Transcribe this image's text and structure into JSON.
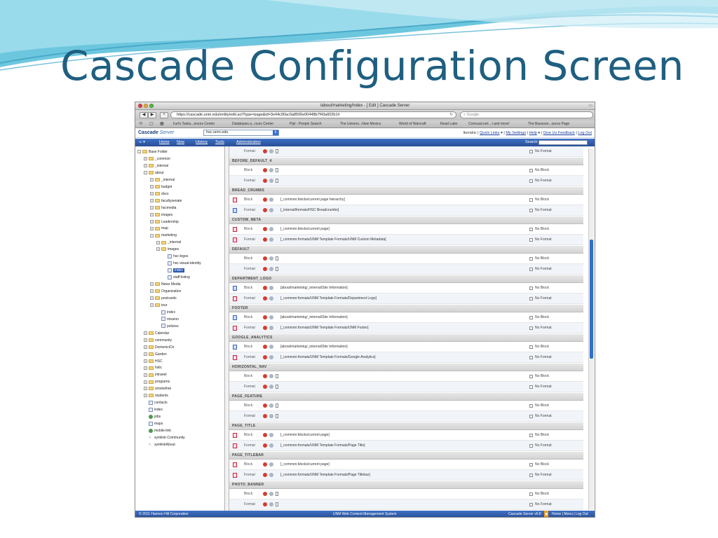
{
  "slide": {
    "title": "Cascade Configuration Screen"
  },
  "browser": {
    "window_title": "/about/marketing/index - [ Edit ] Cascade Server",
    "url": "https://cascade.unm.edu/entity/edit.act?type=page&id=3e44c90ac0a8506e00448b7f43a602b1#",
    "search_placeholder": "Google",
    "bookmarks": [
      "Icel's Tasks...ences Center",
      "Databases a...nces Center",
      "Pipl - People Search",
      "The Univers...New Mexico",
      "World of Warcraft",
      "Read Later",
      "Comcast.net:...l and more!",
      "The Bassoon...ource Page"
    ]
  },
  "app": {
    "logo_main": "Cascade",
    "logo_sub": "Server",
    "site": "hsc.unm.edu",
    "user": "lkendric",
    "links": [
      "Quick Links",
      "My Settings",
      "Help",
      "Give Us Feedback",
      "Log Out"
    ],
    "menu": [
      "Home",
      "New",
      "History",
      "Tools",
      "Administration"
    ],
    "search_label": "Search"
  },
  "tree": [
    {
      "label": "Base Folder",
      "indent": 0,
      "icon": "folder",
      "exp": "-"
    },
    {
      "label": "_common",
      "indent": 1,
      "icon": "folder",
      "exp": "+"
    },
    {
      "label": "_internal",
      "indent": 1,
      "icon": "folder",
      "exp": "+"
    },
    {
      "label": "about",
      "indent": 1,
      "icon": "folder",
      "exp": "-"
    },
    {
      "label": "_internal",
      "indent": 2,
      "icon": "folder",
      "exp": "+"
    },
    {
      "label": "budget",
      "indent": 2,
      "icon": "folder",
      "exp": "+"
    },
    {
      "label": "docs",
      "indent": 2,
      "icon": "folder",
      "exp": "+"
    },
    {
      "label": "facultysenate",
      "indent": 2,
      "icon": "folder",
      "exp": "+"
    },
    {
      "label": "hscmedia",
      "indent": 2,
      "icon": "folder",
      "exp": "+"
    },
    {
      "label": "images",
      "indent": 2,
      "icon": "folder",
      "exp": "+"
    },
    {
      "label": "Leadership",
      "indent": 2,
      "icon": "folder",
      "exp": "+"
    },
    {
      "label": "map",
      "indent": 2,
      "icon": "folder",
      "exp": "+"
    },
    {
      "label": "marketing",
      "indent": 2,
      "icon": "folder",
      "exp": "-"
    },
    {
      "label": "_internal",
      "indent": 3,
      "icon": "folder",
      "exp": "+"
    },
    {
      "label": "images",
      "indent": 3,
      "icon": "folder",
      "exp": "+"
    },
    {
      "label": "hsc-logos",
      "indent": 4,
      "icon": "page"
    },
    {
      "label": "hsc-visual-identity",
      "indent": 4,
      "icon": "page"
    },
    {
      "label": "index",
      "indent": 4,
      "icon": "page",
      "selected": true
    },
    {
      "label": "staff-listing",
      "indent": 4,
      "icon": "page"
    },
    {
      "label": "News Media",
      "indent": 2,
      "icon": "folder",
      "exp": "+"
    },
    {
      "label": "Organization",
      "indent": 2,
      "icon": "folder",
      "exp": "+"
    },
    {
      "label": "postcards",
      "indent": 2,
      "icon": "folder",
      "exp": "+"
    },
    {
      "label": "tour",
      "indent": 2,
      "icon": "folder",
      "exp": "+"
    },
    {
      "label": "index",
      "indent": 3,
      "icon": "page"
    },
    {
      "label": "mission",
      "indent": 3,
      "icon": "page"
    },
    {
      "label": "policies",
      "indent": 3,
      "icon": "page"
    },
    {
      "label": "Calendar",
      "indent": 1,
      "icon": "folder",
      "exp": "+"
    },
    {
      "label": "community",
      "indent": 1,
      "icon": "folder",
      "exp": "+"
    },
    {
      "label": "DomeniciCtr",
      "indent": 1,
      "icon": "folder",
      "exp": "+"
    },
    {
      "label": "Garden",
      "indent": 1,
      "icon": "folder",
      "exp": "+"
    },
    {
      "label": "HSC",
      "indent": 1,
      "icon": "folder",
      "exp": "+"
    },
    {
      "label": "hslic",
      "indent": 1,
      "icon": "folder",
      "exp": "+"
    },
    {
      "label": "intranet",
      "indent": 1,
      "icon": "folder",
      "exp": "+"
    },
    {
      "label": "programs",
      "indent": 1,
      "icon": "folder",
      "exp": "+"
    },
    {
      "label": "smokefree",
      "indent": 1,
      "icon": "folder",
      "exp": "+"
    },
    {
      "label": "students",
      "indent": 1,
      "icon": "folder",
      "exp": "+"
    },
    {
      "label": "contacts",
      "indent": 1,
      "icon": "page"
    },
    {
      "label": "index",
      "indent": 1,
      "icon": "page"
    },
    {
      "label": "jobs",
      "indent": 1,
      "icon": "globe"
    },
    {
      "label": "maps",
      "indent": 1,
      "icon": "page"
    },
    {
      "label": "mobile-link",
      "indent": 1,
      "icon": "globe"
    },
    {
      "label": "symlink-Community",
      "indent": 1,
      "icon": "symlink"
    },
    {
      "label": "symlinkAbout",
      "indent": 1,
      "icon": "symlink"
    }
  ],
  "regions": [
    {
      "kind": "format",
      "path": "[]",
      "icon": "none"
    },
    {
      "kind": "section",
      "name": "BEFORE_DEFAULT_4"
    },
    {
      "kind": "block",
      "path": "[]",
      "icon": "none"
    },
    {
      "kind": "format",
      "path": "[]",
      "icon": "none"
    },
    {
      "kind": "section",
      "name": "BREAD_CRUMBS"
    },
    {
      "kind": "block",
      "path": "[_common:blocks/current page hierarchy]",
      "icon": "red"
    },
    {
      "kind": "format",
      "path": "[_internal/formats/HSC Breadcrumbs]",
      "icon": "blue"
    },
    {
      "kind": "section",
      "name": "CUSTOM_META"
    },
    {
      "kind": "block",
      "path": "[_common:blocks/current page]",
      "icon": "red"
    },
    {
      "kind": "format",
      "path": "[_common:formats/UNM Template Formats/UNM Custom Metadata]",
      "icon": "red"
    },
    {
      "kind": "section",
      "name": "DEFAULT"
    },
    {
      "kind": "block",
      "path": "[]",
      "icon": "none"
    },
    {
      "kind": "format",
      "path": "[]",
      "icon": "none"
    },
    {
      "kind": "section",
      "name": "DEPARTMENT_LOGO"
    },
    {
      "kind": "block",
      "path": "[about/marketing/_internal/Site Information]",
      "icon": "blue"
    },
    {
      "kind": "format",
      "path": "[_common:formats/UNM Template Formats/Department Logo]",
      "icon": "red"
    },
    {
      "kind": "section",
      "name": "FOOTER"
    },
    {
      "kind": "block",
      "path": "[about/marketing/_internal/Site Information]",
      "icon": "blue"
    },
    {
      "kind": "format",
      "path": "[_common:formats/UNM Template Formats/UNM Footer]",
      "icon": "red"
    },
    {
      "kind": "section",
      "name": "GOOGLE_ANALYTICS"
    },
    {
      "kind": "block",
      "path": "[about/marketing/_internal/Site Information]",
      "icon": "blue"
    },
    {
      "kind": "format",
      "path": "[_common:formats/UNM Template Formats/Google Analytics]",
      "icon": "red"
    },
    {
      "kind": "section",
      "name": "HORIZONTAL_NAV"
    },
    {
      "kind": "block",
      "path": "[]",
      "icon": "none"
    },
    {
      "kind": "format",
      "path": "[]",
      "icon": "none"
    },
    {
      "kind": "section",
      "name": "PAGE_FEATURE"
    },
    {
      "kind": "block",
      "path": "[]",
      "icon": "none"
    },
    {
      "kind": "format",
      "path": "[]",
      "icon": "none"
    },
    {
      "kind": "section",
      "name": "PAGE_TITLE"
    },
    {
      "kind": "block",
      "path": "[_common:blocks/current page]",
      "icon": "red"
    },
    {
      "kind": "format",
      "path": "[_common:formats/UNM Template Formats/Page Title]",
      "icon": "red"
    },
    {
      "kind": "section",
      "name": "PAGE_TITLEBAR"
    },
    {
      "kind": "block",
      "path": "[_common:blocks/current page]",
      "icon": "red"
    },
    {
      "kind": "format",
      "path": "[_common:formats/UNM Template Formats/Page Titlebar]",
      "icon": "red"
    },
    {
      "kind": "section",
      "name": "PHOTO_BANNER"
    },
    {
      "kind": "block",
      "path": "[]",
      "icon": "none"
    },
    {
      "kind": "format",
      "path": "[]",
      "icon": "none"
    }
  ],
  "labels": {
    "block": "Block",
    "format": "Format",
    "no_block": "No Block",
    "no_format": "No Format"
  },
  "status": {
    "copyright": "© 2011 Hannon Hill Corporation",
    "center": "UNM Web Content Management System",
    "version": "Cascade Server v6.8",
    "links": "Home | Menu | Log Out"
  },
  "colors": {
    "title": "#1f5f80",
    "menubar": "#2f5aa8",
    "accent": "#2a58b0"
  }
}
